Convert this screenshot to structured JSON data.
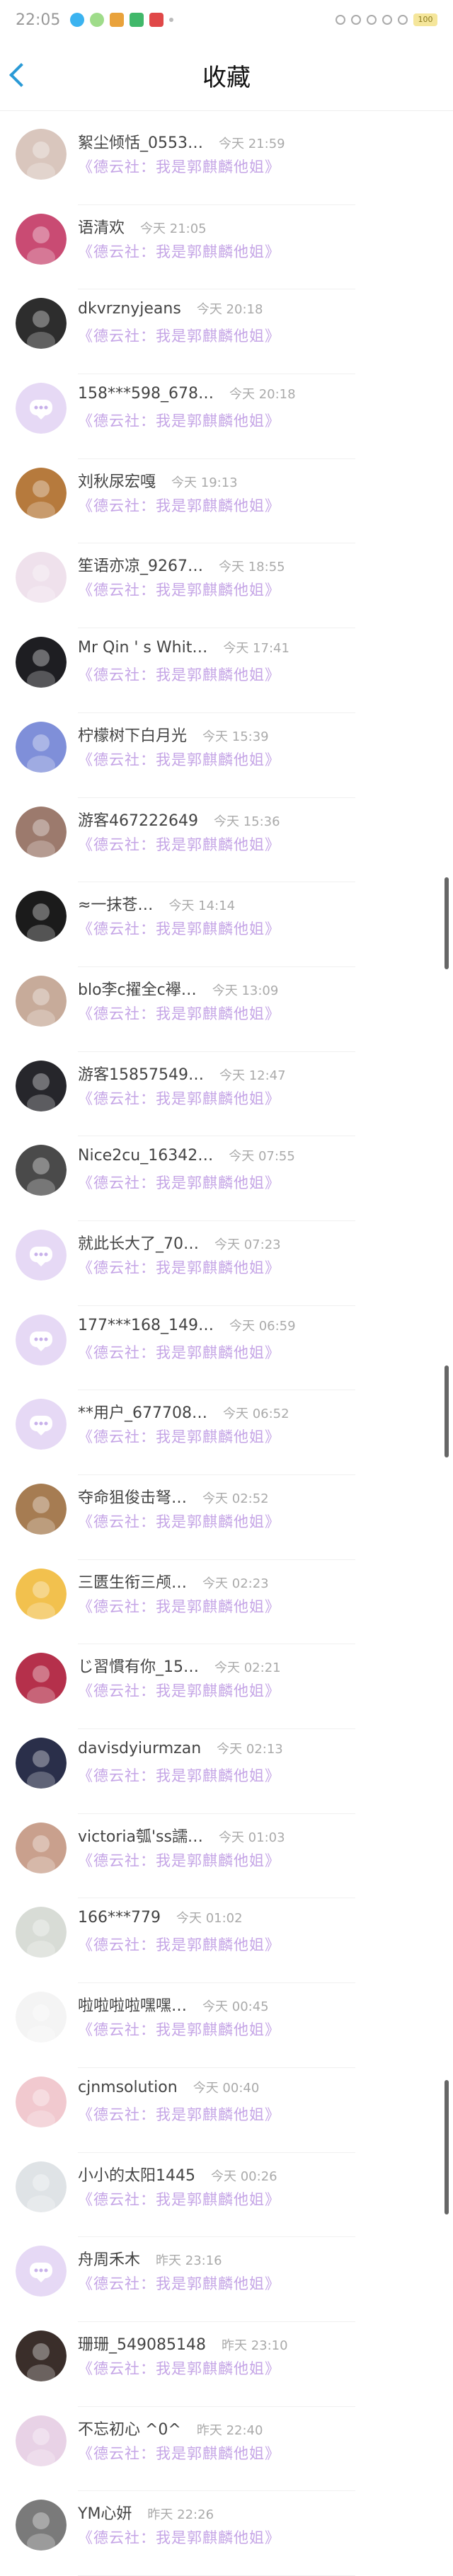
{
  "status": {
    "time": "22:05",
    "battery": "100"
  },
  "nav": {
    "title": "收藏"
  },
  "items": [
    {
      "name": "絮尘倾恬_0553…",
      "time": "今天 21:59",
      "sub": "《德云社：我是郭麒麟他姐》",
      "color": "#d9c6bd"
    },
    {
      "name": "语清欢",
      "time": "今天 21:05",
      "sub": "《德云社：我是郭麒麟他姐》",
      "color": "#c94b73"
    },
    {
      "name": "dkvrznyjeans",
      "time": "今天 20:18",
      "sub": "《德云社：我是郭麒麟他姐》",
      "color": "#2d2d2d"
    },
    {
      "name": "158***598_678…",
      "time": "今天 20:18",
      "sub": "《德云社：我是郭麒麟他姐》",
      "color": "#e6d9f5",
      "chat": true
    },
    {
      "name": "刘秋尿宏嘎",
      "time": "今天 19:13",
      "sub": "《德云社：我是郭麒麟他姐》",
      "color": "#b67a3d"
    },
    {
      "name": "笙语亦凉_9267…",
      "time": "今天 18:55",
      "sub": "《德云社：我是郭麒麟他姐》",
      "color": "#efe1ec"
    },
    {
      "name": "Mr Qin ' s Whit…",
      "time": "今天 17:41",
      "sub": "《德云社：我是郭麒麟他姐》",
      "color": "#1e1e22"
    },
    {
      "name": "柠檬树下白月光",
      "time": "今天 15:39",
      "sub": "《德云社：我是郭麒麟他姐》",
      "color": "#7f8fd9"
    },
    {
      "name": "游客467222649",
      "time": "今天 15:36",
      "sub": "《德云社：我是郭麒麟他姐》",
      "color": "#9c7a6d"
    },
    {
      "name": "≈一抹苍…",
      "time": "今天 14:14",
      "sub": "《德云社：我是郭麒麟他姐》",
      "color": "#1b1b1b"
    },
    {
      "name": "blo李c擢全c襷…",
      "time": "今天 13:09",
      "sub": "《德云社：我是郭麒麟他姐》",
      "color": "#c7ab9a"
    },
    {
      "name": "游客15857549…",
      "time": "今天 12:47",
      "sub": "《德云社：我是郭麒麟他姐》",
      "color": "#26262b"
    },
    {
      "name": "Nice2cu_16342…",
      "time": "今天 07:55",
      "sub": "《德云社：我是郭麒麟他姐》",
      "color": "#4a4a4a"
    },
    {
      "name": "就此长大了_70…",
      "time": "今天 07:23",
      "sub": "《德云社：我是郭麒麟他姐》",
      "color": "#e6d9f5",
      "chat": true
    },
    {
      "name": "177***168_149…",
      "time": "今天 06:59",
      "sub": "《德云社：我是郭麒麟他姐》",
      "color": "#e6d9f5",
      "chat": true
    },
    {
      "name": "**用户_677708…",
      "time": "今天 06:52",
      "sub": "《德云社：我是郭麒麟他姐》",
      "color": "#e6d9f5",
      "chat": true
    },
    {
      "name": "夺命狙俊击弩…",
      "time": "今天 02:52",
      "sub": "《德云社：我是郭麒麟他姐》",
      "color": "#a67c52"
    },
    {
      "name": "三匮生衔三颅…",
      "time": "今天 02:23",
      "sub": "《德云社：我是郭麒麟他姐》",
      "color": "#f2c14e"
    },
    {
      "name": "じ習慣有你_15…",
      "time": "今天 02:21",
      "sub": "《德云社：我是郭麒麟他姐》",
      "color": "#b5304b"
    },
    {
      "name": "davisdyiurmzan",
      "time": "今天 02:13",
      "sub": "《德云社：我是郭麒麟他姐》",
      "color": "#2a2f4a"
    },
    {
      "name": "victoria瓠'ss譳…",
      "time": "今天 01:03",
      "sub": "《德云社：我是郭麒麟他姐》",
      "color": "#c9a08d"
    },
    {
      "name": "166***779",
      "time": "今天 01:02",
      "sub": "《德云社：我是郭麒麟他姐》",
      "color": "#d8dcd6"
    },
    {
      "name": "啦啦啦啦嘿嘿…",
      "time": "今天 00:45",
      "sub": "《德云社：我是郭麒麟他姐》",
      "color": "#f4f4f4"
    },
    {
      "name": "cjnmsolution",
      "time": "今天 00:40",
      "sub": "《德云社：我是郭麒麟他姐》",
      "color": "#f1c9cf"
    },
    {
      "name": "小小的太阳1445",
      "time": "今天 00:26",
      "sub": "《德云社：我是郭麒麟他姐》",
      "color": "#dfe3e6"
    },
    {
      "name": "舟周禾木",
      "time": "昨天 23:16",
      "sub": "《德云社：我是郭麒麟他姐》",
      "color": "#e6d9f5",
      "chat": true
    },
    {
      "name": "珊珊_549085148",
      "time": "昨天 23:10",
      "sub": "《德云社：我是郭麒麟他姐》",
      "color": "#3a2e2a"
    },
    {
      "name": "不忘初心 ^0^",
      "time": "昨天 22:40",
      "sub": "《德云社：我是郭麒麟他姐》",
      "color": "#e8d2e6"
    },
    {
      "name": "YM心妍",
      "time": "昨天 22:26",
      "sub": "《德云社：我是郭麒麟他姐》",
      "color": "#7a7a7a"
    }
  ]
}
